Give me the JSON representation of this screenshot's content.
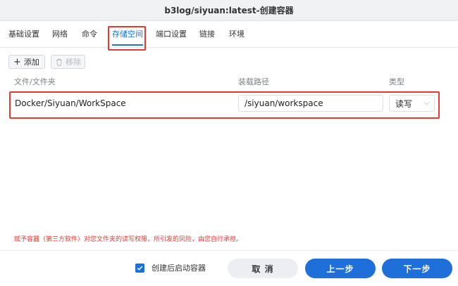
{
  "window": {
    "title": "b3log/siyuan:latest-创建容器"
  },
  "tabs": [
    {
      "label": "基础设置"
    },
    {
      "label": "网络"
    },
    {
      "label": "命令"
    },
    {
      "label": "存储空间"
    },
    {
      "label": "端口设置"
    },
    {
      "label": "链接"
    },
    {
      "label": "环境"
    }
  ],
  "active_tab": "存储空间",
  "toolbar": {
    "add_label": "添加",
    "remove_label": "移除"
  },
  "table": {
    "columns": [
      "文件/文件夹",
      "装载路径",
      "类型"
    ],
    "rows": [
      {
        "folder": "Docker/Siyuan/WorkSpace",
        "mount_path": "/siyuan/workspace",
        "type": "读写"
      }
    ]
  },
  "warning": "赋予容器（第三方软件）对您文件夹的读写权限，所引发的风险，由您自行承担。",
  "footer": {
    "checkbox_label": "创建后启动容器",
    "checkbox_checked": true,
    "cancel_label": "取 消",
    "prev_label": "上一步",
    "next_label": "下一步"
  },
  "colors": {
    "accent": "#1e6fd9",
    "highlight": "#e53935",
    "warning_text": "#e53935"
  }
}
